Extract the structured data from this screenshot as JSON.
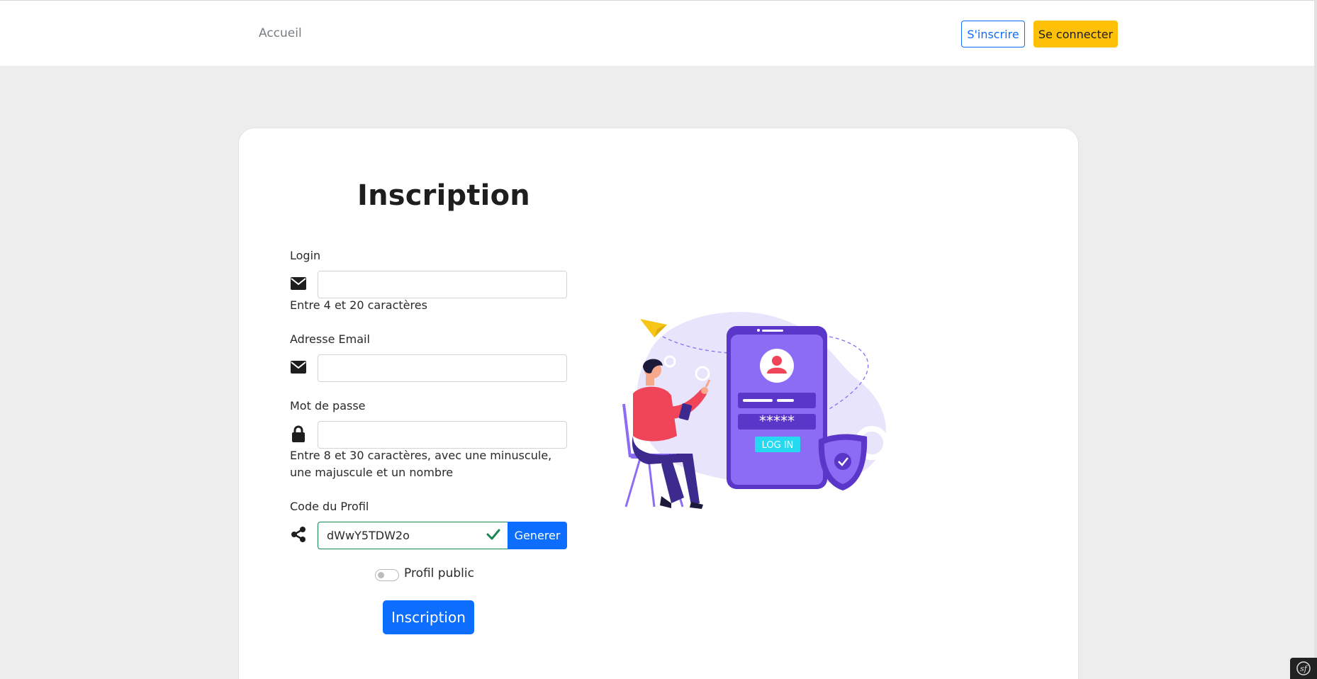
{
  "nav": {
    "home_link": "Accueil",
    "signup_button": "S'inscrire",
    "login_button": "Se connecter"
  },
  "form": {
    "title": "Inscription",
    "login": {
      "label": "Login",
      "icon": "envelope-icon",
      "value": "",
      "help": "Entre 4 et 20 caractères"
    },
    "email": {
      "label": "Adresse Email",
      "icon": "envelope-icon",
      "value": ""
    },
    "password": {
      "label": "Mot de passe",
      "icon": "lock-icon",
      "value": "",
      "help": "Entre 8 et 30 caractères, avec une minuscule, une majuscule et un nombre"
    },
    "profile_code": {
      "label": "Code du Profil",
      "icon": "share-icon",
      "value": "dWwY5TDW2o",
      "generate_button": "Generer"
    },
    "public_profile": {
      "label": "Profil public",
      "checked": false
    },
    "submit_button": "Inscription"
  },
  "illustration": {
    "phone_button": "LOG IN",
    "password_mask": "*****"
  },
  "colors": {
    "primary": "#0d6efd",
    "warning": "#ffc107",
    "success": "#198754",
    "background": "#ededed",
    "illustration_purple": "#8c6cf5"
  }
}
